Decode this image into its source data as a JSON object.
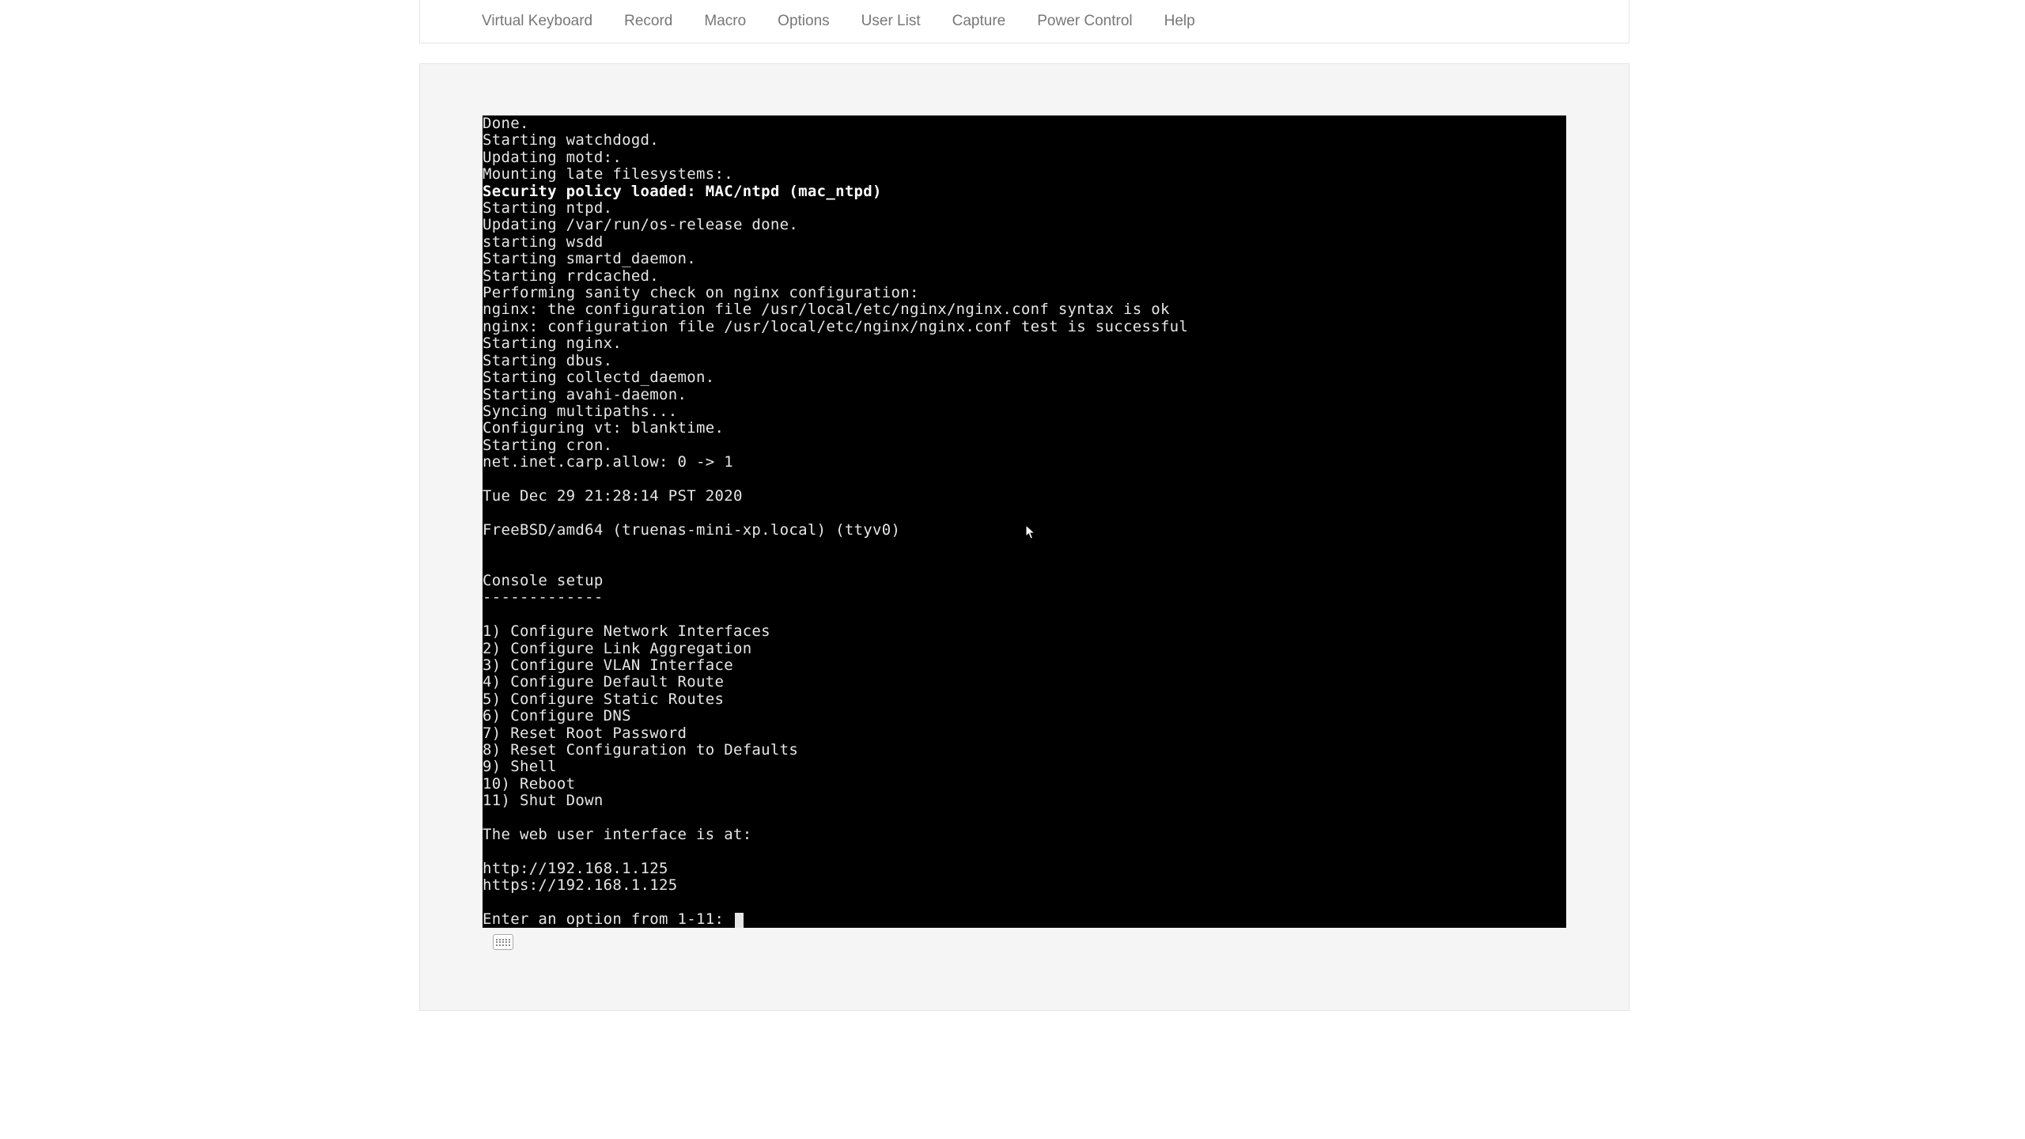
{
  "menu": {
    "virtual_keyboard": "Virtual Keyboard",
    "record": "Record",
    "macro": "Macro",
    "options": "Options",
    "user_list": "User List",
    "capture": "Capture",
    "power_control": "Power Control",
    "help": "Help"
  },
  "console": {
    "boot_lines": [
      "Done.",
      "Starting watchdogd.",
      "Updating motd:.",
      "Mounting late filesystems:."
    ],
    "security_line": "Security policy loaded: MAC/ntpd (mac_ntpd)",
    "post_security_lines": [
      "Starting ntpd.",
      "Updating /var/run/os-release done.",
      "starting wsdd",
      "Starting smartd_daemon.",
      "Starting rrdcached.",
      "Performing sanity check on nginx configuration:",
      "nginx: the configuration file /usr/local/etc/nginx/nginx.conf syntax is ok",
      "nginx: configuration file /usr/local/etc/nginx/nginx.conf test is successful",
      "Starting nginx.",
      "Starting dbus.",
      "Starting collectd_daemon.",
      "Starting avahi-daemon.",
      "Syncing multipaths...",
      "Configuring vt: blanktime.",
      "Starting cron.",
      "net.inet.carp.allow: 0 -> 1",
      "",
      "Tue Dec 29 21:28:14 PST 2020",
      "",
      "FreeBSD/amd64 (truenas-mini-xp.local) (ttyv0)",
      "",
      "",
      "Console setup",
      "-------------",
      "",
      "1) Configure Network Interfaces",
      "2) Configure Link Aggregation",
      "3) Configure VLAN Interface",
      "4) Configure Default Route",
      "5) Configure Static Routes",
      "6) Configure DNS",
      "7) Reset Root Password",
      "8) Reset Configuration to Defaults",
      "9) Shell",
      "10) Reboot",
      "11) Shut Down",
      "",
      "The web user interface is at:",
      "",
      "http://192.168.1.125",
      "https://192.168.1.125",
      ""
    ],
    "prompt": "Enter an option from 1-11: "
  }
}
